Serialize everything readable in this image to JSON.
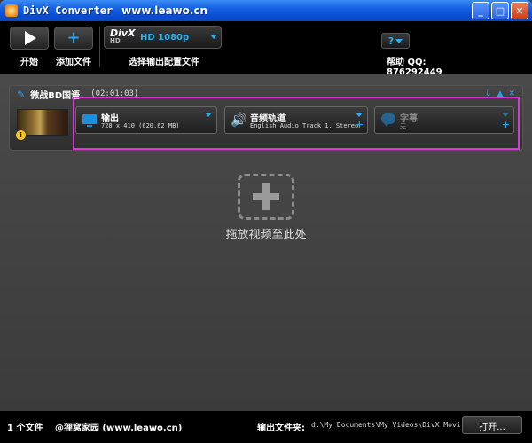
{
  "window": {
    "title": "DivX Converter",
    "url": "www.leawo.cn",
    "minimize_label": "_",
    "maximize_label": "□",
    "close_label": "✕"
  },
  "toolbar": {
    "start_label": "开始",
    "add_file_label": "添加文件",
    "profile_brand": "DivX",
    "profile_brand_sub": "HD",
    "profile_value": "HD 1080p",
    "profile_label": "选择输出配置文件",
    "help_button_label": "?",
    "help_text": "帮助 QQ: 876292449"
  },
  "file": {
    "title": "微战BD国语",
    "duration": "(02:01:03)",
    "output": {
      "title": "输出",
      "detail": "728 x 410 (620.62 MB)"
    },
    "audio": {
      "title": "音频轨道",
      "detail": "English Audio Track 1, Stereo"
    },
    "subtitle": {
      "title": "字幕",
      "detail": "无"
    }
  },
  "drop_zone": {
    "text": "拖放视频至此处"
  },
  "status": {
    "file_count": "1 个文件",
    "credit": "@狸窝家园 (www.leawo.cn)",
    "output_folder_label": "输出文件夹:",
    "output_path": "d:\\My Documents\\My Videos\\DivX Movies",
    "open_button": "打开..."
  },
  "colors": {
    "accent": "#2d9ee8",
    "highlight_border": "#d63ad6"
  }
}
